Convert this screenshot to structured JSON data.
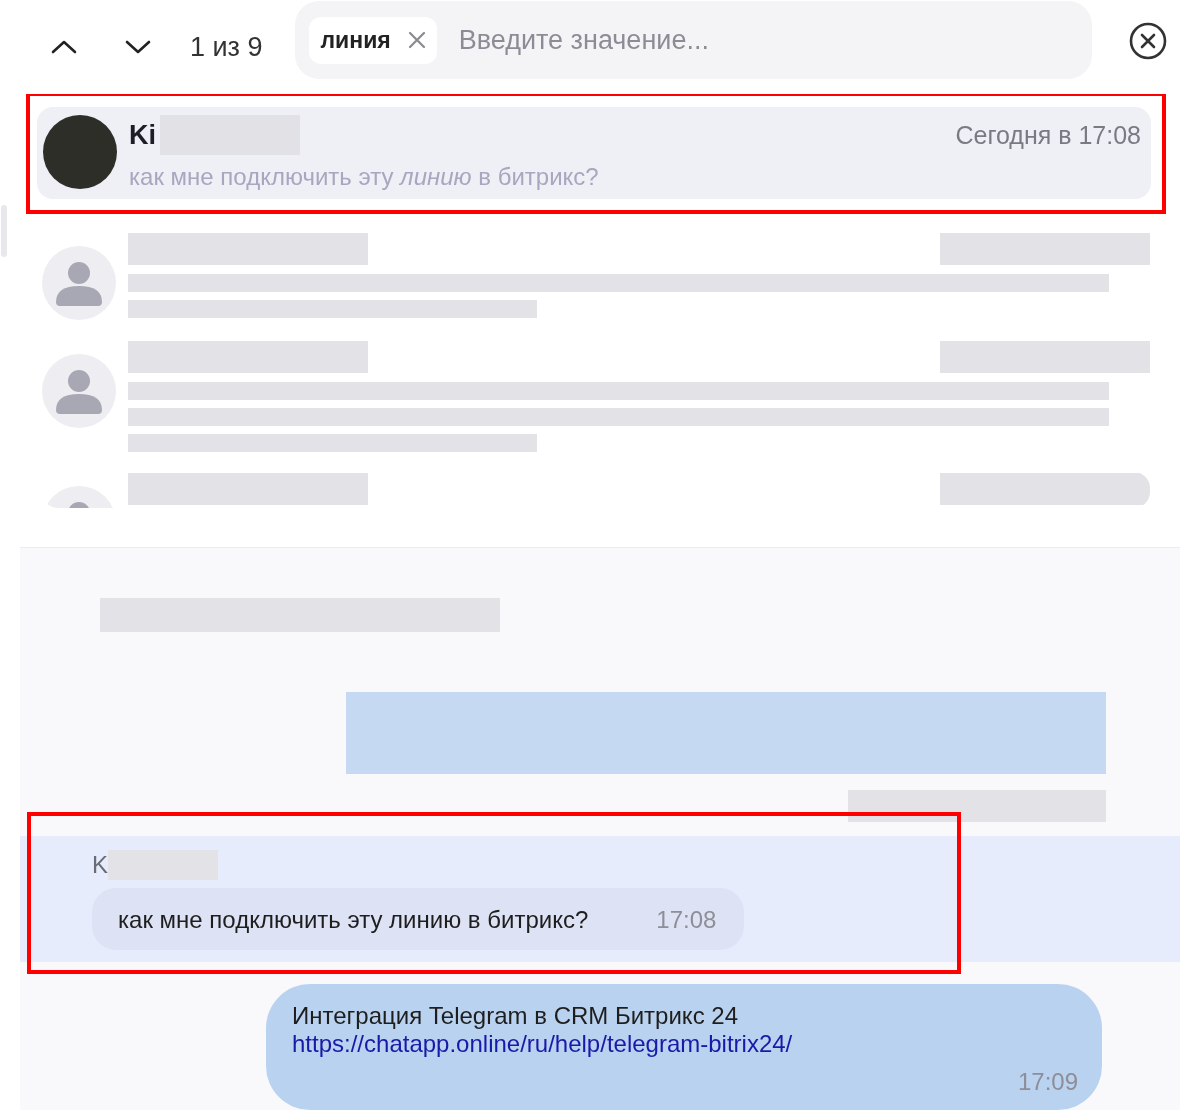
{
  "search_bar": {
    "counter": "1 из 9",
    "chip": {
      "label": "линия"
    },
    "placeholder": "Введите значение..."
  },
  "results": [
    {
      "kind": "match",
      "selected": true,
      "annotated": true,
      "name": "Ki",
      "time": "Сегодня в 17:08",
      "snippet": "как мне подключить эту *линию* в битрикс?"
    },
    {
      "kind": "blurred",
      "selected": false
    },
    {
      "kind": "blurred-long",
      "selected": false
    },
    {
      "kind": "blurred-cut",
      "selected": false
    }
  ],
  "messages": [
    {
      "kind": "blurred-incoming"
    },
    {
      "kind": "blurred-outgoing"
    },
    {
      "kind": "incoming",
      "highlighted": true,
      "annotated": true,
      "author": "K",
      "text": "как мне подключить эту линию в битрикс?",
      "time": "17:08"
    },
    {
      "kind": "outgoing",
      "text": "Интеграция Telegram в CRM Битрикс 24",
      "link": "https://chatapp.online/ru/help/telegram-bitrix24/",
      "time": "17:09"
    }
  ]
}
